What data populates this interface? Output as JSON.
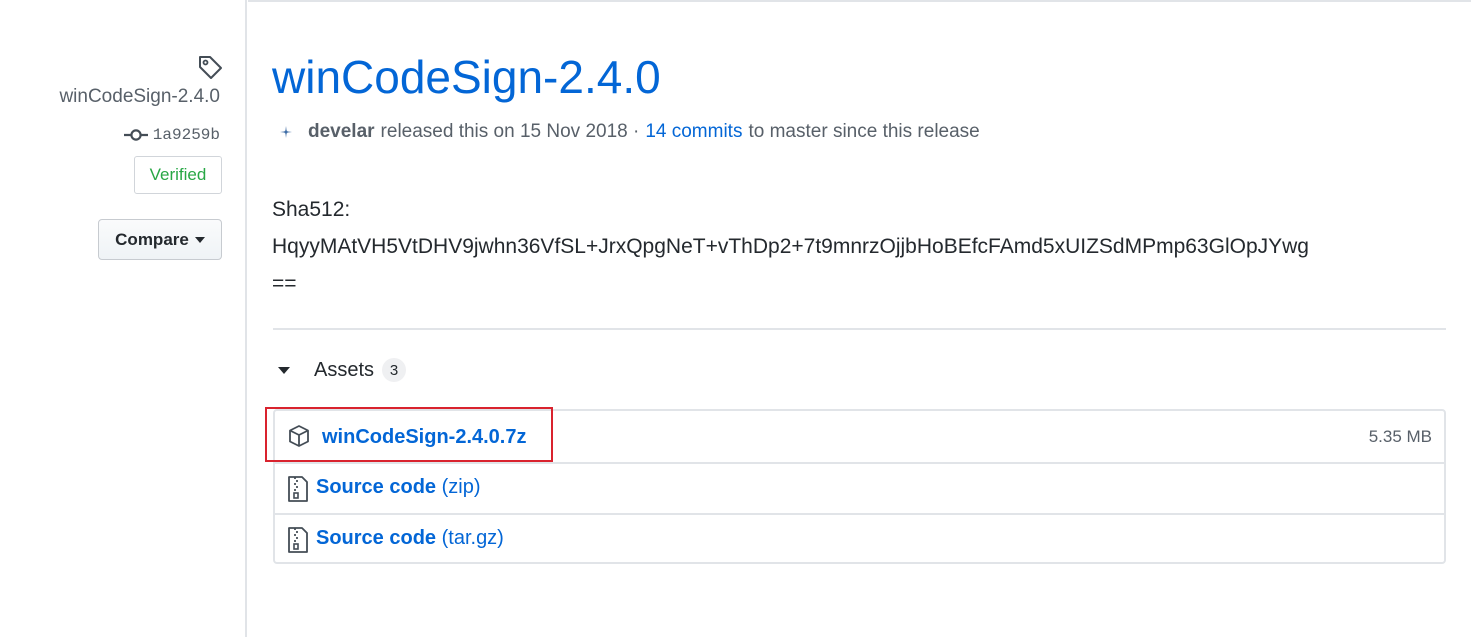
{
  "sidebar": {
    "tag_name": "winCodeSign-2.4.0",
    "commit_sha": "1a9259b",
    "verified_label": "Verified",
    "compare_label": "Compare"
  },
  "release": {
    "title": "winCodeSign-2.4.0",
    "author": "develar",
    "released_text": "released this on 15 Nov 2018 ·",
    "commits_link": "14 commits",
    "since_text": "to master since this release"
  },
  "body": {
    "line1": "Sha512:",
    "line2": "HqyyMAtVH5VtDHV9jwhn36VfSL+JrxQpgNeT+vThDp2+7t9mnrzOjjbHoBEfcFAmd5xUIZSdMPmp63GlOpJYwg",
    "line3": "=="
  },
  "assets": {
    "label": "Assets",
    "count": "3",
    "items": [
      {
        "name": "winCodeSign-2.4.0.7z",
        "ext": "",
        "size": "5.35 MB",
        "icon": "package-icon"
      },
      {
        "name": "Source code",
        "ext": "(zip)",
        "size": "",
        "icon": "file-zip-icon"
      },
      {
        "name": "Source code",
        "ext": "(tar.gz)",
        "size": "",
        "icon": "file-zip-icon"
      }
    ]
  },
  "colors": {
    "link": "#0366d6",
    "verified": "#28a745",
    "highlight": "#d9232e"
  }
}
